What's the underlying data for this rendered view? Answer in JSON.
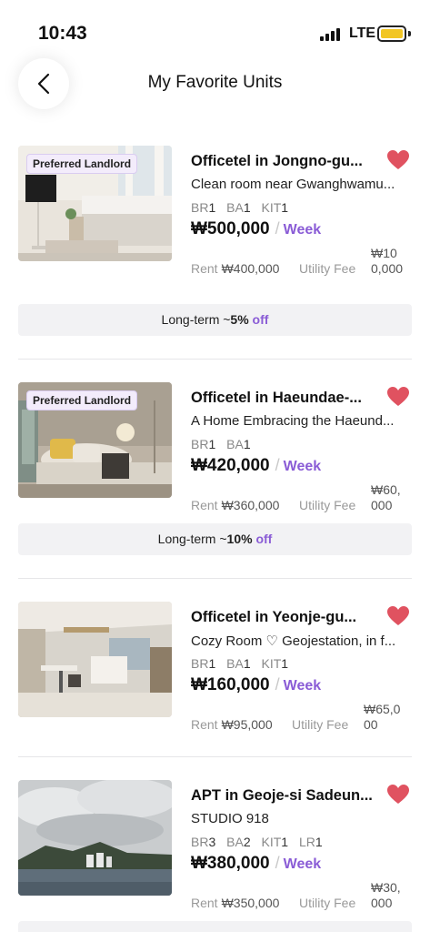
{
  "status_bar": {
    "time": "10:43",
    "network": "LTE"
  },
  "header": {
    "title": "My Favorite Units"
  },
  "units": [
    {
      "badge": "Preferred Landlord",
      "title": "Officetel in Jongno-gu...",
      "subtitle": "Clean room near Gwanghwamu...",
      "rooms": [
        {
          "k": "BR",
          "v": "1"
        },
        {
          "k": "BA",
          "v": "1"
        },
        {
          "k": "KIT",
          "v": "1"
        }
      ],
      "price": "₩500,000",
      "period": "Week",
      "rent_label": "Rent",
      "rent_value": "₩400,000",
      "utility_label": "Utility Fee",
      "utility_value": "₩100,000",
      "promo": {
        "prefix": "Long-term ~",
        "pct": "5%",
        "suffix": "off"
      }
    },
    {
      "badge": "Preferred Landlord",
      "title": "Officetel in Haeundae-...",
      "subtitle": "A Home Embracing the Haeund...",
      "rooms": [
        {
          "k": "BR",
          "v": "1"
        },
        {
          "k": "BA",
          "v": "1"
        }
      ],
      "price": "₩420,000",
      "period": "Week",
      "rent_label": "Rent",
      "rent_value": "₩360,000",
      "utility_label": "Utility Fee",
      "utility_value": "₩60,000",
      "promo": {
        "prefix": "Long-term ~",
        "pct": "10%",
        "suffix": "off"
      }
    },
    {
      "badge": "",
      "title": "Officetel in Yeonje-gu...",
      "subtitle": "Cozy Room ♡ Geojestation, in f...",
      "rooms": [
        {
          "k": "BR",
          "v": "1"
        },
        {
          "k": "BA",
          "v": "1"
        },
        {
          "k": "KIT",
          "v": "1"
        }
      ],
      "price": "₩160,000",
      "period": "Week",
      "rent_label": "Rent",
      "rent_value": "₩95,000",
      "utility_label": "Utility Fee",
      "utility_value": "₩65,000",
      "promo": null
    },
    {
      "badge": "",
      "title": "APT in Geoje-si Sadeun...",
      "subtitle": "STUDIO 918",
      "rooms": [
        {
          "k": "BR",
          "v": "3"
        },
        {
          "k": "BA",
          "v": "2"
        },
        {
          "k": "KIT",
          "v": "1"
        },
        {
          "k": "LR",
          "v": "1"
        }
      ],
      "price": "₩380,000",
      "period": "Week",
      "rent_label": "Rent",
      "rent_value": "₩350,000",
      "utility_label": "Utility Fee",
      "utility_value": "₩30,000",
      "promo": null
    }
  ],
  "colors": {
    "accent": "#8a5cd6",
    "heart": "#e05260",
    "badge_bg": "#f3ecfb"
  },
  "icons": {
    "back": "chevron-left-icon",
    "favorite": "heart-filled-icon",
    "signal": "cellular-signal-icon",
    "battery": "battery-icon"
  }
}
